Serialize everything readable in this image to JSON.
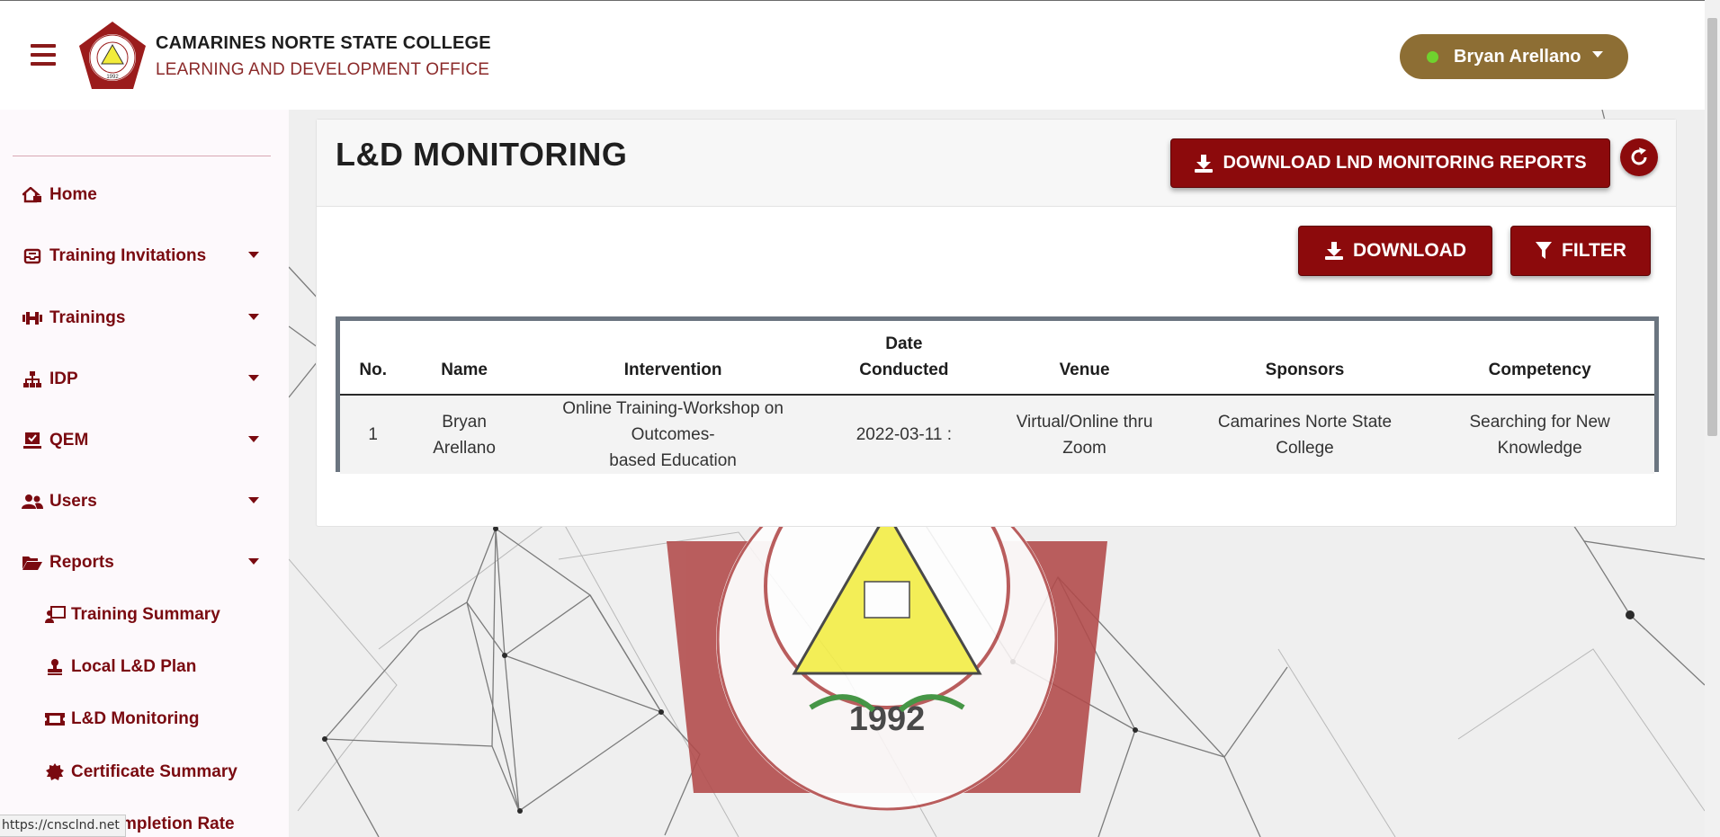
{
  "header": {
    "org_name": "CAMARINES NORTE STATE COLLEGE",
    "org_sub": "LEARNING AND DEVELOPMENT OFFICE",
    "user_name": "Bryan Arellano",
    "user_button_color": "#8d6e34",
    "online_dot_color": "#6fd22e"
  },
  "sidebar": {
    "items": [
      {
        "label": "Home",
        "icon": "home-icon"
      },
      {
        "label": "Training Invitations",
        "icon": "inbox-icon"
      },
      {
        "label": "Trainings",
        "icon": "dumbbell-icon"
      },
      {
        "label": "IDP",
        "icon": "sitemap-icon"
      },
      {
        "label": "QEM",
        "icon": "checkbox-icon"
      },
      {
        "label": "Users",
        "icon": "users-icon"
      },
      {
        "label": "Reports",
        "icon": "folder-open-icon"
      }
    ],
    "report_items": [
      {
        "label": "Training Summary",
        "icon": "chalkboard-icon"
      },
      {
        "label": "Local L&D Plan",
        "icon": "stamp-icon"
      },
      {
        "label": "L&D Monitoring",
        "icon": "ticket-icon"
      },
      {
        "label": "Certificate Summary",
        "icon": "certificate-icon"
      },
      {
        "label": "mpletion Rate",
        "icon": ""
      }
    ]
  },
  "status_url": "https://cnsclnd.net",
  "main": {
    "title": "L&D MONITORING",
    "download_reports_label": "DOWNLOAD LND MONITORING REPORTS",
    "download_label": "DOWNLOAD",
    "filter_label": "FILTER",
    "accent_color": "#8c0a0c"
  },
  "logo": {
    "year": "1992"
  },
  "table": {
    "headers": {
      "no": "No.",
      "name": "Name",
      "intervention": "Intervention",
      "date_line1": "Date",
      "date_line2": "Conducted",
      "venue": "Venue",
      "sponsors": "Sponsors",
      "competency": "Competency"
    },
    "rows": [
      {
        "no": "1",
        "name_line1": "Bryan",
        "name_line2": "Arellano",
        "intervention_line1": "Online Training-Workshop on Outcomes-",
        "intervention_line2": "based Education",
        "date": "2022-03-11 :",
        "venue_line1": "Virtual/Online thru",
        "venue_line2": "Zoom",
        "sponsors_line1": "Camarines Norte State",
        "sponsors_line2": "College",
        "competency_line1": "Searching for New",
        "competency_line2": "Knowledge"
      }
    ]
  }
}
